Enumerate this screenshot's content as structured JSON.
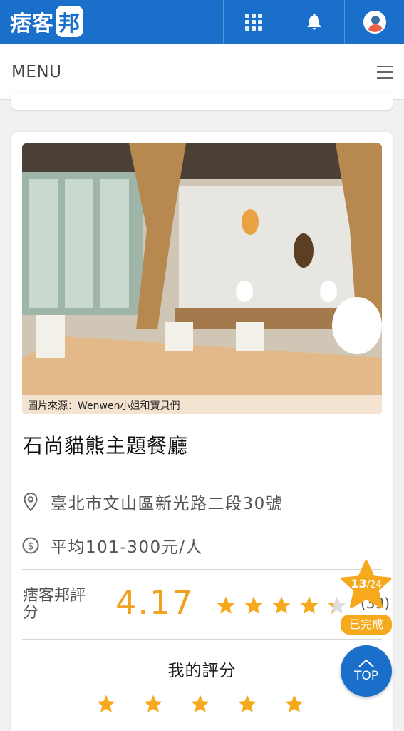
{
  "header": {
    "logo_text": "痞客",
    "logo_badge": "邦",
    "icons": [
      "apps-grid-icon",
      "bell-icon",
      "avatar"
    ]
  },
  "menu": {
    "label": "MENU"
  },
  "card": {
    "image_caption": "圖片來源：Wenwen小姐和寶貝們",
    "title": "石尚貓熊主題餐廳",
    "address": "臺北市文山區新光路二段30號",
    "price": "平均101-300元/人",
    "score_label": "痞客邦評分",
    "score_value": "4.17",
    "score_count": "(39)",
    "my_rating_label": "我的評分"
  },
  "badge": {
    "current": "13",
    "total": "/24",
    "status": "已完成"
  },
  "top_button": {
    "label": "TOP"
  },
  "colors": {
    "brand": "#1a6fcb",
    "accent": "#f0a11d",
    "star": "#f7a91e"
  }
}
